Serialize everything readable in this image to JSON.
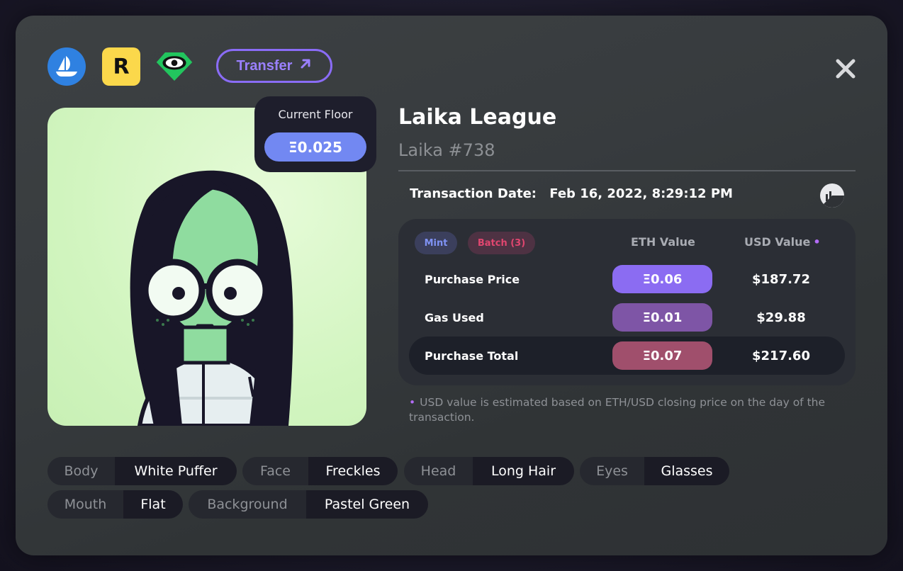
{
  "toolbar": {
    "transfer_label": "Transfer",
    "opensea_icon": "opensea-icon",
    "rarible_icon": "rarible-icon",
    "looksrare_icon": "looksrare-icon",
    "rarible_letter": "R"
  },
  "floor": {
    "label": "Current Floor",
    "value": "Ξ0.025"
  },
  "nft": {
    "collection": "Laika League",
    "token": "Laika #738"
  },
  "transaction": {
    "label": "Transaction Date:",
    "date": "Feb 16, 2022, 8:29:12 PM"
  },
  "values": {
    "badges": {
      "mint": "Mint",
      "batch": "Batch (3)"
    },
    "headers": {
      "eth": "ETH Value",
      "usd": "USD Value",
      "usd_marker": "•"
    },
    "rows": [
      {
        "label": "Purchase Price",
        "eth": "Ξ0.06",
        "usd": "$187.72"
      },
      {
        "label": "Gas Used",
        "eth": "Ξ0.01",
        "usd": "$29.88"
      },
      {
        "label": "Purchase Total",
        "eth": "Ξ0.07",
        "usd": "$217.60"
      }
    ]
  },
  "footnote": {
    "marker": "•",
    "text": "USD value is estimated based on ETH/USD closing price on the day of the transaction."
  },
  "traits": [
    {
      "key": "Body",
      "value": "White Puffer"
    },
    {
      "key": "Face",
      "value": "Freckles"
    },
    {
      "key": "Head",
      "value": "Long Hair"
    },
    {
      "key": "Eyes",
      "value": "Glasses"
    },
    {
      "key": "Mouth",
      "value": "Flat"
    },
    {
      "key": "Background",
      "value": "Pastel Green"
    }
  ],
  "colors": {
    "accent_purple": "#8a6cf6",
    "floor_pill": "#7288f2",
    "price_pill": "#8b6cf2",
    "gas_pill": "#7e55a6",
    "total_pill": "#a04f6c",
    "mint_text": "#7f92f4",
    "batch_text": "#e0466f"
  }
}
